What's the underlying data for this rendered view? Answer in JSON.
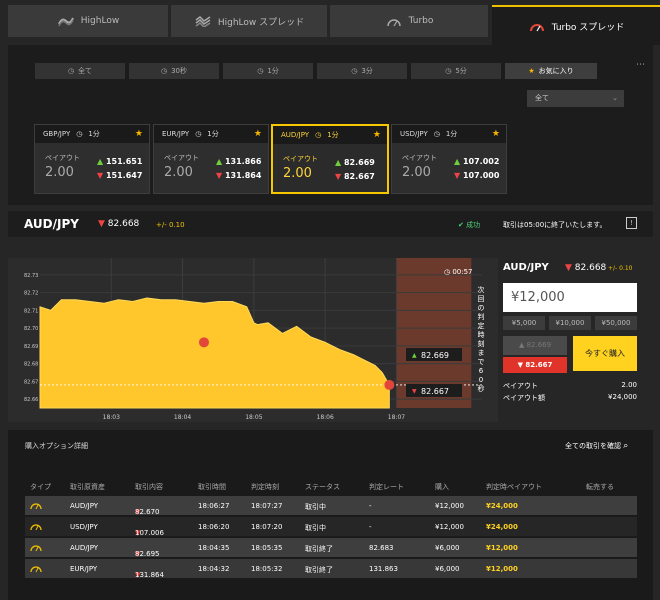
{
  "tabs": [
    {
      "label": "HighLow",
      "icon": "highlow-icon"
    },
    {
      "label": "HighLow スプレッド",
      "icon": "highlow-spread-icon"
    },
    {
      "label": "Turbo",
      "icon": "turbo-gauge-icon"
    },
    {
      "label": "Turbo スプレッド",
      "icon": "turbo-spread-gauge-icon",
      "active": true
    }
  ],
  "filters": [
    "全て",
    "30秒",
    "1分",
    "3分",
    "5分",
    "お気に入り"
  ],
  "menu_icon": "⋯",
  "dropdown": {
    "value": "全て"
  },
  "cards": [
    {
      "pair": "GBP/JPY",
      "dur": "1分",
      "label": "ペイアウト",
      "payout": "2.00",
      "high": "151.651",
      "low": "151.647"
    },
    {
      "pair": "EUR/JPY",
      "dur": "1分",
      "label": "ペイアウト",
      "payout": "2.00",
      "high": "131.866",
      "low": "131.864"
    },
    {
      "pair": "AUD/JPY",
      "dur": "1分",
      "label": "ペイアウト",
      "payout": "2.00",
      "high": "82.669",
      "low": "82.667",
      "active": true
    },
    {
      "pair": "USD/JPY",
      "dur": "1分",
      "label": "ペイアウト",
      "payout": "2.00",
      "high": "107.002",
      "low": "107.000"
    }
  ],
  "header": {
    "pair": "AUD/JPY",
    "rate": "82.668",
    "change": "+/- 0.10",
    "status": "成功",
    "message": "取引は05:00に終了いたします。"
  },
  "chart_data": {
    "type": "area",
    "x_ticks": [
      "18:03",
      "18:04",
      "18:05",
      "18:06",
      "18:07"
    ],
    "y_ticks": [
      "82.73",
      "82.72",
      "82.71",
      "82.70",
      "82.69",
      "82.68",
      "82.67",
      "82.66"
    ],
    "ylim": [
      82.655,
      82.735
    ],
    "xlim": [
      0,
      6.2
    ],
    "series": [
      {
        "x": [
          0,
          0.15,
          0.3,
          0.5,
          0.7,
          0.9,
          1.1,
          1.3,
          1.5,
          1.7,
          1.9,
          2.1,
          2.3,
          2.5,
          2.7,
          2.9,
          3.0,
          3.05,
          3.2,
          3.4,
          3.6,
          3.8,
          4.0,
          4.2,
          4.4,
          4.5,
          4.7,
          4.8,
          4.9
        ],
        "y": [
          82.712,
          82.71,
          82.716,
          82.716,
          82.715,
          82.714,
          82.716,
          82.715,
          82.717,
          82.716,
          82.716,
          82.715,
          82.714,
          82.715,
          82.715,
          82.712,
          82.703,
          82.702,
          82.703,
          82.697,
          82.701,
          82.695,
          82.692,
          82.688,
          82.685,
          82.683,
          82.679,
          82.675,
          82.668
        ]
      }
    ],
    "markers": [
      {
        "x": 2.3,
        "y": 82.692
      },
      {
        "x": 4.9,
        "y": 82.668
      }
    ],
    "current_line": 82.668,
    "countdown": "00:57",
    "vertical_text": "次回の判定時刻まで60秒",
    "label_high": "82.669",
    "label_low": "82.667"
  },
  "panel": {
    "pair": "AUD/JPY",
    "rate": "82.668",
    "change": "+/- 0.10",
    "amount": "¥12,000",
    "presets": [
      "¥5,000",
      "¥10,000",
      "¥50,000"
    ],
    "high_rate": "82.669",
    "low_rate": "82.667",
    "buy_label": "今すぐ購入",
    "payout_label": "ペイアウト",
    "payout_value": "2.00",
    "payout_amount_label": "ペイアウト額",
    "payout_amount_value": "¥24,000"
  },
  "table": {
    "title": "購入オプション詳細",
    "check_all": "全ての取引を確認",
    "headers": [
      "タイプ",
      "取引原資産",
      "取引内容",
      "取引時間",
      "判定時刻",
      "ステータス",
      "判定レート",
      "購入",
      "判定時ペイアウト",
      "転売する"
    ],
    "rows": [
      {
        "pair": "AUD/JPY",
        "rate": "82.670",
        "time": "18:06:27",
        "judge": "18:07:27",
        "status": "取引中",
        "jrate": "-",
        "buy": "¥12,000",
        "payout": "¥24,000"
      },
      {
        "pair": "USD/JPY",
        "rate": "107.006",
        "time": "18:06:20",
        "judge": "18:07:20",
        "status": "取引中",
        "jrate": "-",
        "buy": "¥12,000",
        "payout": "¥24,000"
      },
      {
        "pair": "AUD/JPY",
        "rate": "82.695",
        "time": "18:04:35",
        "judge": "18:05:35",
        "status": "取引終了",
        "jrate": "82.683",
        "buy": "¥6,000",
        "payout": "¥12,000"
      },
      {
        "pair": "EUR/JPY",
        "rate": "131.864",
        "time": "18:04:32",
        "judge": "18:05:32",
        "status": "取引終了",
        "jrate": "131.863",
        "buy": "¥6,000",
        "payout": "¥12,000"
      }
    ]
  },
  "colors": {
    "accent": "#ffd21f",
    "up": "#6fce3b",
    "down": "#e44",
    "chart_fill": "#ffc72c",
    "zone": "#6b3a2c"
  }
}
